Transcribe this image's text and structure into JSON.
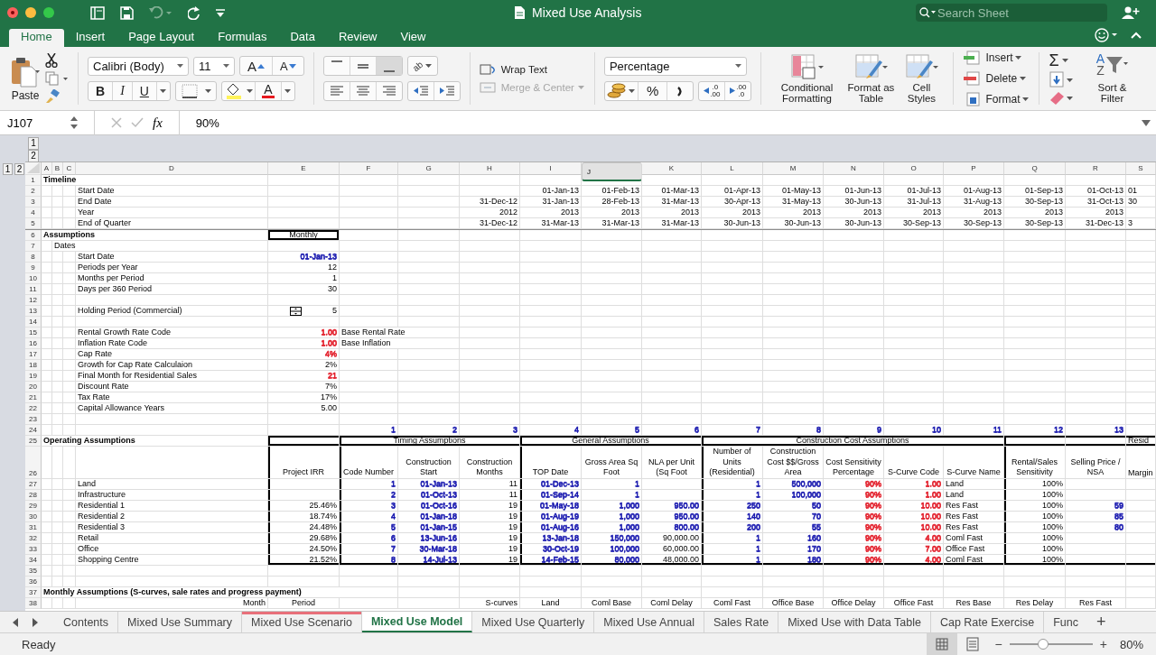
{
  "title_bar": {
    "title": "Mixed Use Analysis",
    "search": {
      "placeholder": "Search Sheet"
    }
  },
  "ribbon_tabs": [
    {
      "label": "Home",
      "selected": true
    },
    {
      "label": "Insert",
      "selected": false
    },
    {
      "label": "Page Layout",
      "selected": false
    },
    {
      "label": "Formulas",
      "selected": false
    },
    {
      "label": "Data",
      "selected": false
    },
    {
      "label": "Review",
      "selected": false
    },
    {
      "label": "View",
      "selected": false
    }
  ],
  "ribbon": {
    "paste": "Paste",
    "font_name": "Calibri (Body)",
    "font_size": "11",
    "grow": "A",
    "shrink": "A",
    "bold": "B",
    "italic": "I",
    "underline": "U",
    "font_color": "A",
    "orientation": "ab",
    "wrap_text": "Wrap Text",
    "merge_center": {
      "label": "Merge & Center",
      "disabled": true
    },
    "number_format": "Percentage",
    "percent": "%",
    "increase_decimal": [
      ".0",
      ".00"
    ],
    "decrease_decimal": [
      ".00",
      ".0"
    ],
    "styles": [
      "Conditional Formatting",
      "Format as Table",
      "Cell Styles"
    ],
    "cells": [
      "Insert",
      "Delete",
      "Format"
    ],
    "autosum": "Σ",
    "sort": {
      "label": "Sort & Filter",
      "letters": [
        "A",
        "Z"
      ]
    }
  },
  "formula_bar": {
    "cell": "J107",
    "fx": "fx",
    "value": "90%"
  },
  "sheet": {
    "column_outline_levels": [
      "1",
      "2"
    ],
    "row_outline_levels": [
      "1",
      "2"
    ],
    "columns": [
      {
        "label": "A",
        "selected": false
      },
      {
        "label": "B",
        "selected": false
      },
      {
        "label": "C",
        "selected": false
      },
      {
        "label": "D",
        "selected": false
      },
      {
        "label": "E",
        "selected": false
      },
      {
        "label": "F",
        "selected": false
      },
      {
        "label": "G",
        "selected": false
      },
      {
        "label": "H",
        "selected": false
      },
      {
        "label": "I",
        "selected": false
      },
      {
        "label": "J",
        "selected": true
      },
      {
        "label": "K",
        "selected": false
      },
      {
        "label": "L",
        "selected": false
      },
      {
        "label": "M",
        "selected": false
      },
      {
        "label": "N",
        "selected": false
      },
      {
        "label": "O",
        "selected": false
      },
      {
        "label": "P",
        "selected": false
      },
      {
        "label": "Q",
        "selected": false
      },
      {
        "label": "R",
        "selected": false
      },
      {
        "label": "S",
        "selected": false
      }
    ],
    "rows": [
      {
        "num": "1",
        "cells": {
          "A": {
            "text": "Timeline",
            "kind": "title"
          }
        }
      },
      {
        "num": "2",
        "cells": {
          "D": {
            "text": "Start Date",
            "kind": "label"
          },
          "I": {
            "text": "01-Jan-13"
          },
          "J": {
            "text": "01-Feb-13"
          },
          "K": {
            "text": "01-Mar-13"
          },
          "L": {
            "text": "01-Apr-13"
          },
          "M": {
            "text": "01-May-13"
          },
          "N": {
            "text": "01-Jun-13"
          },
          "O": {
            "text": "01-Jul-13"
          },
          "P": {
            "text": "01-Aug-13"
          },
          "Q": {
            "text": "01-Sep-13"
          },
          "R": {
            "text": "01-Oct-13"
          },
          "S": {
            "text": "01",
            "kind": "label"
          }
        }
      },
      {
        "num": "3",
        "cells": {
          "D": {
            "text": "End Date",
            "kind": "label"
          },
          "H": {
            "text": "31-Dec-12"
          },
          "I": {
            "text": "31-Jan-13"
          },
          "J": {
            "text": "28-Feb-13"
          },
          "K": {
            "text": "31-Mar-13"
          },
          "L": {
            "text": "30-Apr-13"
          },
          "M": {
            "text": "31-May-13"
          },
          "N": {
            "text": "30-Jun-13"
          },
          "O": {
            "text": "31-Jul-13"
          },
          "P": {
            "text": "31-Aug-13"
          },
          "Q": {
            "text": "30-Sep-13"
          },
          "R": {
            "text": "31-Oct-13"
          },
          "S": {
            "text": "30",
            "kind": "label"
          }
        }
      },
      {
        "num": "4",
        "cells": {
          "D": {
            "text": "Year",
            "kind": "label"
          },
          "H": {
            "text": "2012"
          },
          "I": {
            "text": "2013"
          },
          "J": {
            "text": "2013"
          },
          "K": {
            "text": "2013"
          },
          "L": {
            "text": "2013"
          },
          "M": {
            "text": "2013"
          },
          "N": {
            "text": "2013"
          },
          "O": {
            "text": "2013"
          },
          "P": {
            "text": "2013"
          },
          "Q": {
            "text": "2013"
          },
          "R": {
            "text": "2013"
          }
        }
      },
      {
        "num": "5",
        "group_end": true,
        "cells": {
          "D": {
            "text": "End of Quarter",
            "kind": "label"
          },
          "H": {
            "text": "31-Dec-12"
          },
          "I": {
            "text": "31-Mar-13"
          },
          "J": {
            "text": "31-Mar-13"
          },
          "K": {
            "text": "31-Mar-13"
          },
          "L": {
            "text": "30-Jun-13"
          },
          "M": {
            "text": "30-Jun-13"
          },
          "N": {
            "text": "30-Jun-13"
          },
          "O": {
            "text": "30-Sep-13"
          },
          "P": {
            "text": "30-Sep-13"
          },
          "Q": {
            "text": "30-Sep-13"
          },
          "R": {
            "text": "31-Dec-13"
          },
          "S": {
            "text": "3",
            "kind": "label"
          }
        }
      },
      {
        "num": "6",
        "cells": {
          "A": {
            "text": "Assumptions",
            "kind": "title"
          },
          "E": {
            "text": "Monthly",
            "kind": "centered",
            "boxed": true
          }
        }
      },
      {
        "num": "7",
        "cells": {
          "B": {
            "text": "Dates",
            "kind": "label"
          }
        }
      },
      {
        "num": "8",
        "cells": {
          "D": {
            "text": "Start Date",
            "kind": "label"
          },
          "E": {
            "text": "01-Jan-13",
            "color": "#1c1cb0"
          }
        }
      },
      {
        "num": "9",
        "cells": {
          "D": {
            "text": "Periods per Year",
            "kind": "label"
          },
          "E": {
            "text": "12"
          }
        }
      },
      {
        "num": "10",
        "cells": {
          "D": {
            "text": "Months per Period",
            "kind": "label"
          },
          "E": {
            "text": "1"
          }
        }
      },
      {
        "num": "11",
        "cells": {
          "D": {
            "text": "Days per 360 Period",
            "kind": "label"
          },
          "E": {
            "text": "30"
          }
        }
      },
      {
        "num": "12"
      },
      {
        "num": "13",
        "cells": {
          "D": {
            "text": "Holding Period (Commercial)",
            "kind": "label"
          },
          "E": {
            "text": "5",
            "spinner": true
          }
        }
      },
      {
        "num": "14"
      },
      {
        "num": "15",
        "cells": {
          "D": {
            "text": "Rental Growth Rate Code",
            "kind": "label"
          },
          "E": {
            "text": "1.00",
            "color": "#e3212d"
          },
          "F": {
            "text": "Base Rental Rate",
            "kind": "label"
          }
        }
      },
      {
        "num": "16",
        "cells": {
          "D": {
            "text": "Inflation Rate Code",
            "kind": "label"
          },
          "E": {
            "text": "1.00",
            "color": "#e3212d"
          },
          "F": {
            "text": "Base Inflation",
            "kind": "label"
          }
        }
      },
      {
        "num": "17",
        "cells": {
          "D": {
            "text": "Cap Rate",
            "kind": "label"
          },
          "E": {
            "text": "4%",
            "color": "#e3212d"
          }
        }
      },
      {
        "num": "18",
        "cells": {
          "D": {
            "text": "Growth for Cap Rate Calculaion",
            "kind": "label"
          },
          "E": {
            "text": "2%"
          }
        }
      },
      {
        "num": "19",
        "cells": {
          "D": {
            "text": "Final Month for Residential Sales",
            "kind": "label"
          },
          "E": {
            "text": "21",
            "color": "#e3212d"
          }
        }
      },
      {
        "num": "20",
        "cells": {
          "D": {
            "text": "Discount Rate",
            "kind": "label"
          },
          "E": {
            "text": "7%"
          }
        }
      },
      {
        "num": "21",
        "cells": {
          "D": {
            "text": "Tax Rate",
            "kind": "label"
          },
          "E": {
            "text": "17%"
          }
        }
      },
      {
        "num": "22",
        "cells": {
          "D": {
            "text": "Capital Allowance Years",
            "kind": "label"
          },
          "E": {
            "text": "5.00"
          }
        }
      },
      {
        "num": "23"
      },
      {
        "num": "24",
        "cells": {
          "F": {
            "text": "1",
            "color": "#1c1cb0"
          },
          "G": {
            "text": "2",
            "color": "#1c1cb0"
          },
          "H": {
            "text": "3",
            "color": "#1c1cb0"
          },
          "I": {
            "text": "4",
            "color": "#1c1cb0"
          },
          "J": {
            "text": "5",
            "color": "#1c1cb0"
          },
          "K": {
            "text": "6",
            "color": "#1c1cb0"
          },
          "L": {
            "text": "7",
            "color": "#1c1cb0"
          },
          "M": {
            "text": "8",
            "color": "#1c1cb0"
          },
          "N": {
            "text": "9",
            "color": "#1c1cb0"
          },
          "O": {
            "text": "10",
            "color": "#1c1cb0"
          },
          "P": {
            "text": "11",
            "color": "#1c1cb0"
          },
          "Q": {
            "text": "12",
            "color": "#1c1cb0"
          },
          "R": {
            "text": "13",
            "color": "#1c1cb0"
          }
        }
      },
      {
        "num": "25",
        "kind": "table_head",
        "cells": {
          "A": {
            "text": "Operating Assumptions",
            "kind": "title"
          },
          "F": {
            "text": "Timing Assumptions",
            "kind": "group"
          },
          "I": {
            "text": "General Assumptions",
            "kind": "group"
          },
          "L": {
            "text": "Construction Cost Assumptions",
            "kind": "group"
          },
          "S": {
            "text": "Resid",
            "kind": "label"
          }
        }
      },
      {
        "num": "26",
        "kind": "table_body",
        "cells": {
          "E": {
            "text": "Project IRR",
            "kind": "heading"
          },
          "F": {
            "text": "Code Number",
            "kind": "heading"
          },
          "G": {
            "text": "Construction Start",
            "kind": "heading"
          },
          "H": {
            "text": "Construction Months",
            "kind": "heading"
          },
          "I": {
            "text": "TOP Date",
            "kind": "heading"
          },
          "J": {
            "text": "Gross Area Sq Foot",
            "kind": "heading"
          },
          "K": {
            "text": "NLA per Unit (Sq Foot",
            "kind": "heading"
          },
          "L": {
            "text": "Number of Units (Residential)",
            "kind": "heading"
          },
          "M": {
            "text": "Construction Cost $$/Gross Area",
            "kind": "heading"
          },
          "N": {
            "text": "Cost Sensitivity Percentage",
            "kind": "heading"
          },
          "O": {
            "text": "S-Curve Code",
            "kind": "heading"
          },
          "P": {
            "text": "S-Curve Name",
            "kind": "heading"
          },
          "Q": {
            "text": "Rental/Sales Sensitivity",
            "kind": "heading"
          },
          "R": {
            "text": "Selling Price / NSA",
            "kind": "heading"
          },
          "S": {
            "text": "Margin",
            "kind": "label"
          }
        }
      },
      {
        "num": "27",
        "kind": "table_body",
        "cells": {
          "D": {
            "text": "Land",
            "kind": "label"
          },
          "F": {
            "text": "1",
            "color": "#1c1cb0"
          },
          "G": {
            "text": "01-Jan-13",
            "color": "#1c1cb0"
          },
          "H": {
            "text": "11"
          },
          "I": {
            "text": "01-Dec-13",
            "color": "#1c1cb0"
          },
          "J": {
            "text": "1",
            "color": "#1c1cb0"
          },
          "L": {
            "text": "1",
            "color": "#1c1cb0"
          },
          "M": {
            "text": "500,000",
            "color": "#1c1cb0"
          },
          "N": {
            "text": "90%",
            "color": "#e3212d"
          },
          "O": {
            "text": "1.00",
            "color": "#e3212d"
          },
          "P": {
            "text": "Land",
            "kind": "label"
          },
          "Q": {
            "text": "100%"
          }
        }
      },
      {
        "num": "28",
        "kind": "table_body",
        "cells": {
          "D": {
            "text": "Infrastructure",
            "kind": "label"
          },
          "F": {
            "text": "2",
            "color": "#1c1cb0"
          },
          "G": {
            "text": "01-Oct-13",
            "color": "#1c1cb0"
          },
          "H": {
            "text": "11"
          },
          "I": {
            "text": "01-Sep-14",
            "color": "#1c1cb0"
          },
          "J": {
            "text": "1",
            "color": "#1c1cb0"
          },
          "L": {
            "text": "1",
            "color": "#1c1cb0"
          },
          "M": {
            "text": "100,000",
            "color": "#1c1cb0"
          },
          "N": {
            "text": "90%",
            "color": "#e3212d"
          },
          "O": {
            "text": "1.00",
            "color": "#e3212d"
          },
          "P": {
            "text": "Land",
            "kind": "label"
          },
          "Q": {
            "text": "100%"
          }
        }
      },
      {
        "num": "29",
        "kind": "table_body",
        "cells": {
          "D": {
            "text": "Residential 1",
            "kind": "label"
          },
          "E": {
            "text": "25.46%"
          },
          "F": {
            "text": "3",
            "color": "#1c1cb0"
          },
          "G": {
            "text": "01-Oct-16",
            "color": "#1c1cb0"
          },
          "H": {
            "text": "19"
          },
          "I": {
            "text": "01-May-18",
            "color": "#1c1cb0"
          },
          "J": {
            "text": "1,000",
            "color": "#1c1cb0"
          },
          "K": {
            "text": "950.00",
            "color": "#1c1cb0"
          },
          "L": {
            "text": "250",
            "color": "#1c1cb0"
          },
          "M": {
            "text": "50",
            "color": "#1c1cb0"
          },
          "N": {
            "text": "90%",
            "color": "#e3212d"
          },
          "O": {
            "text": "10.00",
            "color": "#e3212d"
          },
          "P": {
            "text": "Res Fast",
            "kind": "label"
          },
          "Q": {
            "text": "100%"
          },
          "R": {
            "text": "59",
            "color": "#1c1cb0"
          }
        }
      },
      {
        "num": "30",
        "kind": "table_body",
        "cells": {
          "D": {
            "text": "Residential 2",
            "kind": "label"
          },
          "E": {
            "text": "18.74%"
          },
          "F": {
            "text": "4",
            "color": "#1c1cb0"
          },
          "G": {
            "text": "01-Jan-18",
            "color": "#1c1cb0"
          },
          "H": {
            "text": "19"
          },
          "I": {
            "text": "01-Aug-19",
            "color": "#1c1cb0"
          },
          "J": {
            "text": "1,000",
            "color": "#1c1cb0"
          },
          "K": {
            "text": "950.00",
            "color": "#1c1cb0"
          },
          "L": {
            "text": "140",
            "color": "#1c1cb0"
          },
          "M": {
            "text": "70",
            "color": "#1c1cb0"
          },
          "N": {
            "text": "90%",
            "color": "#e3212d"
          },
          "O": {
            "text": "10.00",
            "color": "#e3212d"
          },
          "P": {
            "text": "Res Fast",
            "kind": "label"
          },
          "Q": {
            "text": "100%"
          },
          "R": {
            "text": "85",
            "color": "#1c1cb0"
          }
        }
      },
      {
        "num": "31",
        "kind": "table_body",
        "cells": {
          "D": {
            "text": "Residential 3",
            "kind": "label"
          },
          "E": {
            "text": "24.48%"
          },
          "F": {
            "text": "5",
            "color": "#1c1cb0"
          },
          "G": {
            "text": "01-Jan-15",
            "color": "#1c1cb0"
          },
          "H": {
            "text": "19"
          },
          "I": {
            "text": "01-Aug-16",
            "color": "#1c1cb0"
          },
          "J": {
            "text": "1,000",
            "color": "#1c1cb0"
          },
          "K": {
            "text": "800.00",
            "color": "#1c1cb0"
          },
          "L": {
            "text": "200",
            "color": "#1c1cb0"
          },
          "M": {
            "text": "55",
            "color": "#1c1cb0"
          },
          "N": {
            "text": "90%",
            "color": "#e3212d"
          },
          "O": {
            "text": "10.00",
            "color": "#e3212d"
          },
          "P": {
            "text": "Res Fast",
            "kind": "label"
          },
          "Q": {
            "text": "100%"
          },
          "R": {
            "text": "80",
            "color": "#1c1cb0"
          }
        }
      },
      {
        "num": "32",
        "kind": "table_body",
        "cells": {
          "D": {
            "text": "Retail",
            "kind": "label"
          },
          "E": {
            "text": "29.68%"
          },
          "F": {
            "text": "6",
            "color": "#1c1cb0"
          },
          "G": {
            "text": "13-Jun-16",
            "color": "#1c1cb0"
          },
          "H": {
            "text": "19"
          },
          "I": {
            "text": "13-Jan-18",
            "color": "#1c1cb0"
          },
          "J": {
            "text": "150,000",
            "color": "#1c1cb0"
          },
          "K": {
            "text": "90,000.00"
          },
          "L": {
            "text": "1",
            "color": "#1c1cb0"
          },
          "M": {
            "text": "160",
            "color": "#1c1cb0"
          },
          "N": {
            "text": "90%",
            "color": "#e3212d"
          },
          "O": {
            "text": "4.00",
            "color": "#e3212d"
          },
          "P": {
            "text": "Coml Fast",
            "kind": "label"
          },
          "Q": {
            "text": "100%"
          }
        }
      },
      {
        "num": "33",
        "kind": "table_body",
        "cells": {
          "D": {
            "text": "Office",
            "kind": "label"
          },
          "E": {
            "text": "24.50%"
          },
          "F": {
            "text": "7",
            "color": "#1c1cb0"
          },
          "G": {
            "text": "30-Mar-18",
            "color": "#1c1cb0"
          },
          "H": {
            "text": "19"
          },
          "I": {
            "text": "30-Oct-19",
            "color": "#1c1cb0"
          },
          "J": {
            "text": "100,000",
            "color": "#1c1cb0"
          },
          "K": {
            "text": "60,000.00"
          },
          "L": {
            "text": "1",
            "color": "#1c1cb0"
          },
          "M": {
            "text": "170",
            "color": "#1c1cb0"
          },
          "N": {
            "text": "90%",
            "color": "#e3212d"
          },
          "O": {
            "text": "7.00",
            "color": "#e3212d"
          },
          "P": {
            "text": "Office Fast",
            "kind": "label"
          },
          "Q": {
            "text": "100%"
          }
        }
      },
      {
        "num": "34",
        "kind": "table_foot",
        "cells": {
          "D": {
            "text": "Shopping Centre",
            "kind": "label"
          },
          "E": {
            "text": "21.52%"
          },
          "F": {
            "text": "8",
            "color": "#1c1cb0"
          },
          "G": {
            "text": "14-Jul-13",
            "color": "#1c1cb0"
          },
          "H": {
            "text": "19"
          },
          "I": {
            "text": "14-Feb-15",
            "color": "#1c1cb0"
          },
          "J": {
            "text": "80,000",
            "color": "#1c1cb0"
          },
          "K": {
            "text": "48,000.00"
          },
          "L": {
            "text": "1",
            "color": "#1c1cb0"
          },
          "M": {
            "text": "180",
            "color": "#1c1cb0"
          },
          "N": {
            "text": "90%",
            "color": "#e3212d"
          },
          "O": {
            "text": "4.00",
            "color": "#e3212d"
          },
          "P": {
            "text": "Coml Fast",
            "kind": "label"
          },
          "Q": {
            "text": "100%"
          }
        }
      },
      {
        "num": "35"
      },
      {
        "num": "36"
      },
      {
        "num": "37",
        "cells": {
          "A": {
            "text": "Monthly Assumptions (S-curves, sale rates and progress payment)",
            "kind": "title"
          }
        }
      },
      {
        "num": "38",
        "cells": {
          "D": {
            "text": "Month"
          },
          "E": {
            "text": "Period",
            "kind": "centered"
          },
          "H": {
            "text": "S-curves"
          },
          "I": {
            "text": "Land",
            "kind": "centered"
          },
          "J": {
            "text": "Coml Base",
            "kind": "centered"
          },
          "K": {
            "text": "Coml Delay",
            "kind": "centered"
          },
          "L": {
            "text": "Coml Fast",
            "kind": "centered"
          },
          "M": {
            "text": "Office Base",
            "kind": "centered"
          },
          "N": {
            "text": "Office Delay",
            "kind": "centered"
          },
          "O": {
            "text": "Office Fast",
            "kind": "centered"
          },
          "P": {
            "text": "Res Base",
            "kind": "centered"
          },
          "Q": {
            "text": "Res Delay",
            "kind": "centered"
          },
          "R": {
            "text": "Res Fast",
            "kind": "centered"
          }
        }
      }
    ]
  },
  "sheet_tabs": [
    {
      "label": "Contents",
      "selected": false
    },
    {
      "label": "Mixed Use Summary",
      "selected": false
    },
    {
      "label": "Mixed Use Scenario",
      "selected": false,
      "color": "#e8707a"
    },
    {
      "label": "Mixed Use Model",
      "selected": true
    },
    {
      "label": "Mixed Use Quarterly",
      "selected": false
    },
    {
      "label": "Mixed Use Annual",
      "selected": false
    },
    {
      "label": "Sales Rate",
      "selected": false
    },
    {
      "label": "Mixed Use with Data Table",
      "selected": false
    },
    {
      "label": "Cap Rate Exercise",
      "selected": false
    },
    {
      "label": "Func",
      "selected": false
    }
  ],
  "add_sheet": "+",
  "status_bar": {
    "text": "Ready",
    "zoom_out": "−",
    "zoom_in": "+",
    "zoom_slider": {
      "level": 0.4
    },
    "zoom": "80%"
  }
}
